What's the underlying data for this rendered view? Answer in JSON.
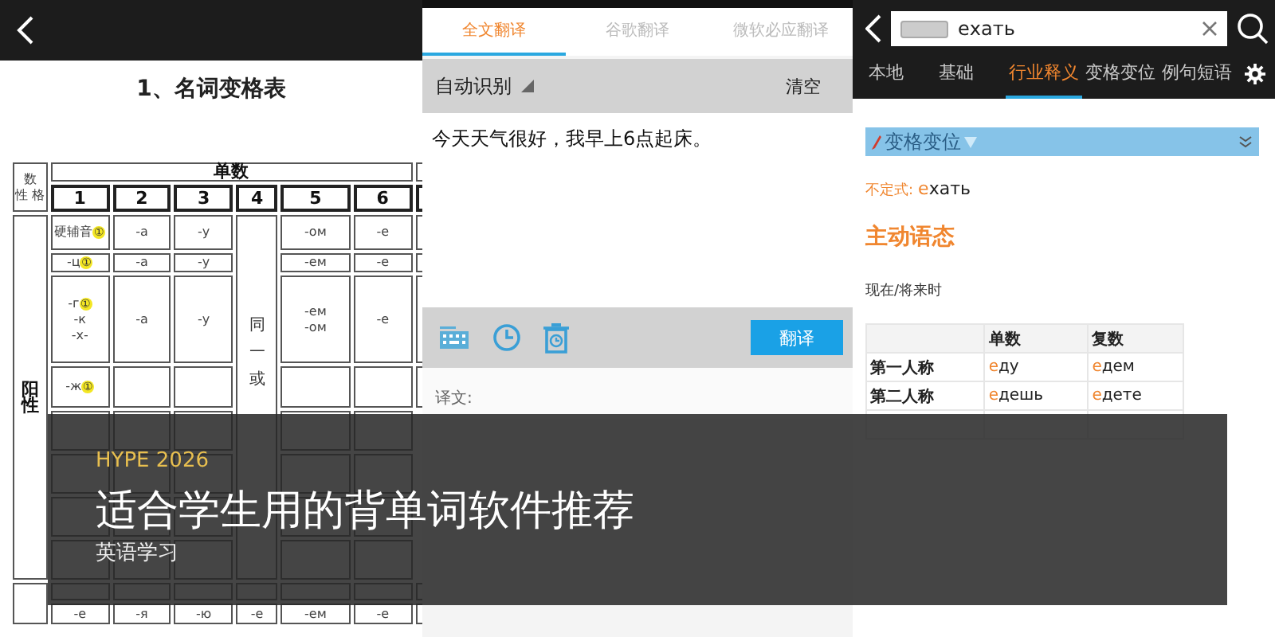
{
  "declension_screen": {
    "title": "1、名词变格表",
    "corner_top": "数",
    "corner_bottom": "性 格",
    "number_header": "单数",
    "case_numbers": [
      "1",
      "2",
      "3",
      "4",
      "5",
      "6"
    ],
    "gender": "阳性",
    "merged_case4": "同一或",
    "masculine_rows": [
      {
        "first": [
          {
            "text": "硬辅音",
            "note": "①"
          }
        ],
        "cells": [
          [
            "-а"
          ],
          [
            "-у"
          ],
          [
            "-ом"
          ],
          [
            "-е"
          ]
        ]
      },
      {
        "first": [
          {
            "text": "-ц",
            "note": "①"
          }
        ],
        "cells": [
          [
            "-а"
          ],
          [
            "-у"
          ],
          [
            "-ем"
          ],
          [
            "-е"
          ]
        ]
      },
      {
        "first": [
          {
            "text": "-г",
            "note": "①"
          },
          {
            "text": "-к"
          },
          {
            "text": "-х-"
          }
        ],
        "cells": [
          [
            "-а"
          ],
          [
            "-у"
          ],
          [
            "-ем",
            "-ом"
          ],
          [
            "-е"
          ]
        ]
      },
      {
        "first": [
          {
            "text": "-ж",
            "note": "①"
          }
        ]
      }
    ],
    "neuter_rows": [
      {
        "cells": [
          [
            "-е"
          ],
          [
            "-я"
          ],
          [
            "-ю"
          ],
          [
            "-е"
          ],
          [
            "-ем"
          ],
          [
            "-е"
          ]
        ]
      }
    ]
  },
  "translator": {
    "tabs": [
      {
        "label": "全文翻译",
        "selected": true
      },
      {
        "label": "谷歌翻译",
        "selected": false
      },
      {
        "label": "微软必应翻译",
        "selected": false
      }
    ],
    "source_language": "自动识别",
    "clear_button": "清空",
    "input_text": "今天天气很好，我早上6点起床。",
    "translate_button": "翻译",
    "result_label": "译文:"
  },
  "dictionary": {
    "query": "ехать",
    "tabs": [
      {
        "label": "本地",
        "selected": false
      },
      {
        "label": "基础",
        "selected": false
      },
      {
        "label": "行业释义",
        "selected": true
      },
      {
        "label": "变格变位",
        "selected": false
      },
      {
        "label": "例句短语",
        "selected": false
      }
    ],
    "section_title": "变格变位",
    "infinitive": {
      "label": "不定式:",
      "forms": [
        {
          "stem": "е",
          "ending": "хать"
        }
      ]
    },
    "voice_title": "主动语态",
    "present": {
      "title": "现在/将来时",
      "columns": [
        "单数",
        "复数"
      ],
      "rows": [
        {
          "person": "第一人称",
          "forms": [
            {
              "stem": "е",
              "ending": "ду"
            },
            {
              "stem": "е",
              "ending": "дем"
            }
          ]
        },
        {
          "person": "第二人称",
          "forms": [
            {
              "stem": "е",
              "ending": "дешь"
            },
            {
              "stem": "е",
              "ending": "дете"
            }
          ]
        }
      ]
    }
  },
  "banner": {
    "tag": "HYPE 2026",
    "title": "适合学生用的背单词软件推荐",
    "category": "英语学习"
  }
}
